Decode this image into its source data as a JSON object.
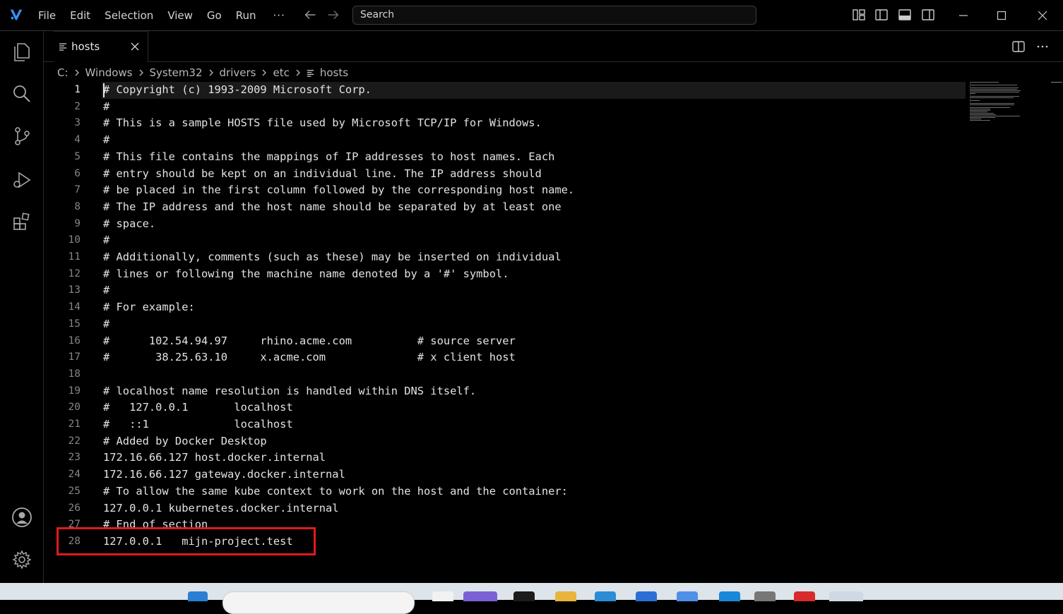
{
  "menu": [
    "File",
    "Edit",
    "Selection",
    "View",
    "Go",
    "Run"
  ],
  "menu_more": "···",
  "search": {
    "placeholder": "Search"
  },
  "tab": {
    "label": "hosts"
  },
  "breadcrumb": [
    "C:",
    "Windows",
    "System32",
    "drivers",
    "etc",
    "hosts"
  ],
  "editor": {
    "current_line": 1,
    "lines": [
      {
        "n": "1",
        "text": "# Copyright (c) 1993-2009 Microsoft Corp."
      },
      {
        "n": "2",
        "text": "#"
      },
      {
        "n": "3",
        "text": "# This is a sample HOSTS file used by Microsoft TCP/IP for Windows."
      },
      {
        "n": "4",
        "text": "#"
      },
      {
        "n": "5",
        "text": "# This file contains the mappings of IP addresses to host names. Each"
      },
      {
        "n": "6",
        "text": "# entry should be kept on an individual line. The IP address should"
      },
      {
        "n": "7",
        "text": "# be placed in the first column followed by the corresponding host name."
      },
      {
        "n": "8",
        "text": "# The IP address and the host name should be separated by at least one"
      },
      {
        "n": "9",
        "text": "# space."
      },
      {
        "n": "10",
        "text": "#"
      },
      {
        "n": "11",
        "text": "# Additionally, comments (such as these) may be inserted on individual"
      },
      {
        "n": "12",
        "text": "# lines or following the machine name denoted by a '#' symbol."
      },
      {
        "n": "13",
        "text": "#"
      },
      {
        "n": "14",
        "text": "# For example:"
      },
      {
        "n": "15",
        "text": "#"
      },
      {
        "n": "16",
        "text": "#      102.54.94.97     rhino.acme.com          # source server"
      },
      {
        "n": "17",
        "text": "#       38.25.63.10     x.acme.com              # x client host"
      },
      {
        "n": "18",
        "text": ""
      },
      {
        "n": "19",
        "text": "# localhost name resolution is handled within DNS itself."
      },
      {
        "n": "20",
        "text": "#   127.0.0.1       localhost"
      },
      {
        "n": "21",
        "text": "#   ::1             localhost"
      },
      {
        "n": "22",
        "text": "# Added by Docker Desktop"
      },
      {
        "n": "23",
        "text": "172.16.66.127 host.docker.internal"
      },
      {
        "n": "24",
        "text": "172.16.66.127 gateway.docker.internal"
      },
      {
        "n": "25",
        "text": "# To allow the same kube context to work on the host and the container:"
      },
      {
        "n": "26",
        "text": "127.0.0.1 kubernetes.docker.internal"
      },
      {
        "n": "27",
        "text": "# End of section"
      },
      {
        "n": "28",
        "text": "127.0.0.1   mijn-project.test"
      }
    ]
  },
  "icons": {
    "title_bar": [
      "app-logo-icon",
      "arrow-left-icon",
      "arrow-right-icon",
      "customize-layout-icon",
      "toggle-primary-sidebar-icon",
      "toggle-panel-icon",
      "toggle-secondary-sidebar-icon",
      "minimize-icon",
      "maximize-icon",
      "close-icon"
    ],
    "activity_bar": [
      "explorer-icon",
      "search-icon",
      "source-control-icon",
      "run-debug-icon",
      "extensions-icon",
      "accounts-icon",
      "settings-gear-icon"
    ],
    "tab": [
      "file-lines-icon",
      "tab-close-icon"
    ],
    "editor_actions": [
      "split-editor-icon",
      "more-actions-icon"
    ]
  },
  "colors": {
    "background": "#000000",
    "text": "#e3e3e3",
    "line_number": "#858585",
    "highlight_box": "#e01b1b",
    "accent": "#3794ff"
  }
}
